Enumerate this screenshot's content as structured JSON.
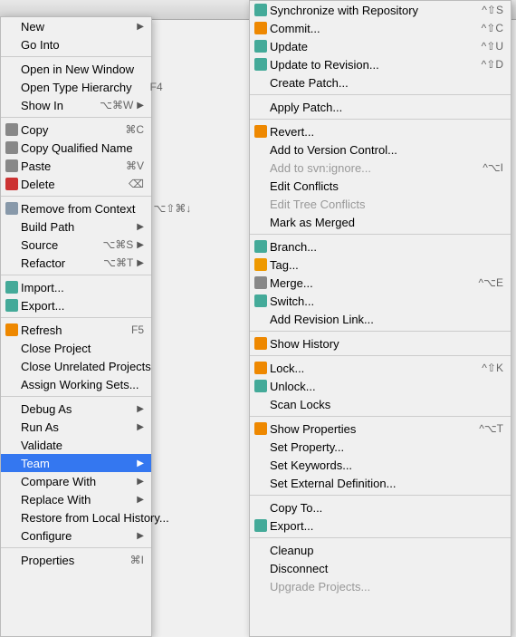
{
  "colors": {
    "selected_bg": "#3477f0",
    "selected_text": "#ffffff",
    "separator": "#cccccc",
    "disabled_text": "#999999",
    "accent_red": "#cc0000"
  },
  "left_menu": {
    "items": [
      {
        "id": "new",
        "label": "New",
        "shortcut": "",
        "has_arrow": true,
        "icon": null,
        "separator_after": false,
        "disabled": false
      },
      {
        "id": "go-into",
        "label": "Go Into",
        "shortcut": "",
        "has_arrow": false,
        "icon": null,
        "separator_after": true,
        "disabled": false
      },
      {
        "id": "open-new-window",
        "label": "Open in New Window",
        "shortcut": "",
        "has_arrow": false,
        "icon": null,
        "separator_after": false,
        "disabled": false
      },
      {
        "id": "open-type-hierarchy",
        "label": "Open Type Hierarchy",
        "shortcut": "F4",
        "has_arrow": false,
        "icon": null,
        "separator_after": false,
        "disabled": false
      },
      {
        "id": "show-in",
        "label": "Show In",
        "shortcut": "⌥⌘W",
        "has_arrow": true,
        "icon": null,
        "separator_after": true,
        "disabled": false
      },
      {
        "id": "copy",
        "label": "Copy",
        "shortcut": "⌘C",
        "has_arrow": false,
        "icon": "copy",
        "separator_after": false,
        "disabled": false
      },
      {
        "id": "copy-qualified-name",
        "label": "Copy Qualified Name",
        "shortcut": "",
        "has_arrow": false,
        "icon": "copy",
        "separator_after": false,
        "disabled": false
      },
      {
        "id": "paste",
        "label": "Paste",
        "shortcut": "⌘V",
        "has_arrow": false,
        "icon": "paste",
        "separator_after": false,
        "disabled": false
      },
      {
        "id": "delete",
        "label": "Delete",
        "shortcut": "⌫",
        "has_arrow": false,
        "icon": "delete",
        "separator_after": true,
        "disabled": false
      },
      {
        "id": "remove-from-context",
        "label": "Remove from Context",
        "shortcut": "⌥⇧⌘↓",
        "has_arrow": false,
        "icon": "remove",
        "separator_after": false,
        "disabled": false
      },
      {
        "id": "build-path",
        "label": "Build Path",
        "shortcut": "",
        "has_arrow": true,
        "icon": null,
        "separator_after": false,
        "disabled": false
      },
      {
        "id": "source",
        "label": "Source",
        "shortcut": "⌥⌘S",
        "has_arrow": true,
        "icon": null,
        "separator_after": false,
        "disabled": false
      },
      {
        "id": "refactor",
        "label": "Refactor",
        "shortcut": "⌥⌘T",
        "has_arrow": true,
        "icon": null,
        "separator_after": true,
        "disabled": false
      },
      {
        "id": "import",
        "label": "Import...",
        "shortcut": "",
        "has_arrow": false,
        "icon": "import",
        "separator_after": false,
        "disabled": false
      },
      {
        "id": "export",
        "label": "Export...",
        "shortcut": "",
        "has_arrow": false,
        "icon": "export",
        "separator_after": true,
        "disabled": false
      },
      {
        "id": "refresh",
        "label": "Refresh",
        "shortcut": "F5",
        "has_arrow": false,
        "icon": "refresh",
        "separator_after": false,
        "disabled": false
      },
      {
        "id": "close-project",
        "label": "Close Project",
        "shortcut": "",
        "has_arrow": false,
        "icon": null,
        "separator_after": false,
        "disabled": false
      },
      {
        "id": "close-unrelated-projects",
        "label": "Close Unrelated Projects",
        "shortcut": "",
        "has_arrow": false,
        "icon": null,
        "separator_after": false,
        "disabled": false
      },
      {
        "id": "assign-working-sets",
        "label": "Assign Working Sets...",
        "shortcut": "",
        "has_arrow": false,
        "icon": null,
        "separator_after": true,
        "disabled": false
      },
      {
        "id": "debug-as",
        "label": "Debug As",
        "shortcut": "",
        "has_arrow": true,
        "icon": null,
        "separator_after": false,
        "disabled": false
      },
      {
        "id": "run-as",
        "label": "Run As",
        "shortcut": "",
        "has_arrow": true,
        "icon": null,
        "separator_after": false,
        "disabled": false
      },
      {
        "id": "validate",
        "label": "Validate",
        "shortcut": "",
        "has_arrow": false,
        "icon": null,
        "separator_after": false,
        "disabled": false
      },
      {
        "id": "team",
        "label": "Team",
        "shortcut": "",
        "has_arrow": true,
        "icon": null,
        "separator_after": false,
        "disabled": false,
        "selected": true
      },
      {
        "id": "compare-with",
        "label": "Compare With",
        "shortcut": "",
        "has_arrow": true,
        "icon": null,
        "separator_after": false,
        "disabled": false
      },
      {
        "id": "replace-with",
        "label": "Replace With",
        "shortcut": "",
        "has_arrow": true,
        "icon": null,
        "separator_after": false,
        "disabled": false
      },
      {
        "id": "restore-from-local-history",
        "label": "Restore from Local History...",
        "shortcut": "",
        "has_arrow": false,
        "icon": null,
        "separator_after": false,
        "disabled": false
      },
      {
        "id": "configure",
        "label": "Configure",
        "shortcut": "",
        "has_arrow": true,
        "icon": null,
        "separator_after": true,
        "disabled": false
      },
      {
        "id": "properties",
        "label": "Properties",
        "shortcut": "⌘I",
        "has_arrow": false,
        "icon": null,
        "separator_after": false,
        "disabled": false
      }
    ]
  },
  "right_menu": {
    "items": [
      {
        "id": "sync-repo",
        "label": "Synchronize with Repository",
        "shortcut": "^⇧S",
        "has_arrow": false,
        "icon": "sync",
        "separator_after": false,
        "disabled": false
      },
      {
        "id": "commit",
        "label": "Commit...",
        "shortcut": "^⇧C",
        "has_arrow": false,
        "icon": "commit",
        "separator_after": false,
        "disabled": false
      },
      {
        "id": "update",
        "label": "Update",
        "shortcut": "^⇧U",
        "has_arrow": false,
        "icon": "update",
        "separator_after": false,
        "disabled": false
      },
      {
        "id": "update-to-revision",
        "label": "Update to Revision...",
        "shortcut": "^⇧D",
        "has_arrow": false,
        "icon": "update-rev",
        "separator_after": false,
        "disabled": false
      },
      {
        "id": "create-patch",
        "label": "Create Patch...",
        "shortcut": "",
        "has_arrow": false,
        "icon": null,
        "separator_after": true,
        "disabled": false
      },
      {
        "id": "apply-patch",
        "label": "Apply Patch...",
        "shortcut": "",
        "has_arrow": false,
        "icon": null,
        "separator_after": true,
        "disabled": false
      },
      {
        "id": "revert",
        "label": "Revert...",
        "shortcut": "",
        "has_arrow": false,
        "icon": "revert",
        "separator_after": false,
        "disabled": false
      },
      {
        "id": "add-to-version-control",
        "label": "Add to Version Control...",
        "shortcut": "",
        "has_arrow": false,
        "icon": null,
        "separator_after": false,
        "disabled": false
      },
      {
        "id": "add-to-svn-ignore",
        "label": "Add to svn:ignore...",
        "shortcut": "^⌥I",
        "has_arrow": false,
        "icon": null,
        "separator_after": false,
        "disabled": true
      },
      {
        "id": "edit-conflicts",
        "label": "Edit Conflicts",
        "shortcut": "",
        "has_arrow": false,
        "icon": null,
        "separator_after": false,
        "disabled": false
      },
      {
        "id": "edit-tree-conflicts",
        "label": "Edit Tree Conflicts",
        "shortcut": "",
        "has_arrow": false,
        "icon": null,
        "separator_after": false,
        "disabled": true
      },
      {
        "id": "mark-as-merged",
        "label": "Mark as Merged",
        "shortcut": "",
        "has_arrow": false,
        "icon": null,
        "separator_after": true,
        "disabled": false
      },
      {
        "id": "branch",
        "label": "Branch...",
        "shortcut": "",
        "has_arrow": false,
        "icon": "branch",
        "separator_after": false,
        "disabled": false
      },
      {
        "id": "tag",
        "label": "Tag...",
        "shortcut": "",
        "has_arrow": false,
        "icon": "tag",
        "separator_after": false,
        "disabled": false
      },
      {
        "id": "merge",
        "label": "Merge...",
        "shortcut": "^⌥E",
        "has_arrow": false,
        "icon": "merge",
        "separator_after": false,
        "disabled": false
      },
      {
        "id": "switch",
        "label": "Switch...",
        "shortcut": "",
        "has_arrow": false,
        "icon": "switch",
        "separator_after": false,
        "disabled": false
      },
      {
        "id": "add-revision-link",
        "label": "Add Revision Link...",
        "shortcut": "",
        "has_arrow": false,
        "icon": null,
        "separator_after": true,
        "disabled": false
      },
      {
        "id": "show-history",
        "label": "Show History",
        "shortcut": "",
        "has_arrow": false,
        "icon": "history",
        "separator_after": true,
        "disabled": false
      },
      {
        "id": "lock",
        "label": "Lock...",
        "shortcut": "^⇧K",
        "has_arrow": false,
        "icon": "lock",
        "separator_after": false,
        "disabled": false
      },
      {
        "id": "unlock",
        "label": "Unlock...",
        "shortcut": "",
        "has_arrow": false,
        "icon": "unlock",
        "separator_after": false,
        "disabled": false
      },
      {
        "id": "scan-locks",
        "label": "Scan Locks",
        "shortcut": "",
        "has_arrow": false,
        "icon": null,
        "separator_after": true,
        "disabled": false
      },
      {
        "id": "show-properties",
        "label": "Show Properties",
        "shortcut": "^⌥T",
        "has_arrow": false,
        "icon": "properties",
        "separator_after": false,
        "disabled": false
      },
      {
        "id": "set-property",
        "label": "Set Property...",
        "shortcut": "",
        "has_arrow": false,
        "icon": null,
        "separator_after": false,
        "disabled": false
      },
      {
        "id": "set-keywords",
        "label": "Set Keywords...",
        "shortcut": "",
        "has_arrow": false,
        "icon": null,
        "separator_after": false,
        "disabled": false
      },
      {
        "id": "set-external-definition",
        "label": "Set External Definition...",
        "shortcut": "",
        "has_arrow": false,
        "icon": null,
        "separator_after": true,
        "disabled": false
      },
      {
        "id": "copy-to",
        "label": "Copy To...",
        "shortcut": "",
        "has_arrow": false,
        "icon": null,
        "separator_after": false,
        "disabled": false
      },
      {
        "id": "export-right",
        "label": "Export...",
        "shortcut": "",
        "has_arrow": false,
        "icon": "export-r",
        "separator_after": true,
        "disabled": false
      },
      {
        "id": "cleanup",
        "label": "Cleanup",
        "shortcut": "",
        "has_arrow": false,
        "icon": null,
        "separator_after": false,
        "disabled": false
      },
      {
        "id": "disconnect",
        "label": "Disconnect",
        "shortcut": "",
        "has_arrow": false,
        "icon": null,
        "separator_after": false,
        "disabled": false
      },
      {
        "id": "upgrade-projects",
        "label": "Upgrade Projects...",
        "shortcut": "",
        "has_arrow": false,
        "icon": null,
        "separator_after": false,
        "disabled": true
      }
    ]
  }
}
